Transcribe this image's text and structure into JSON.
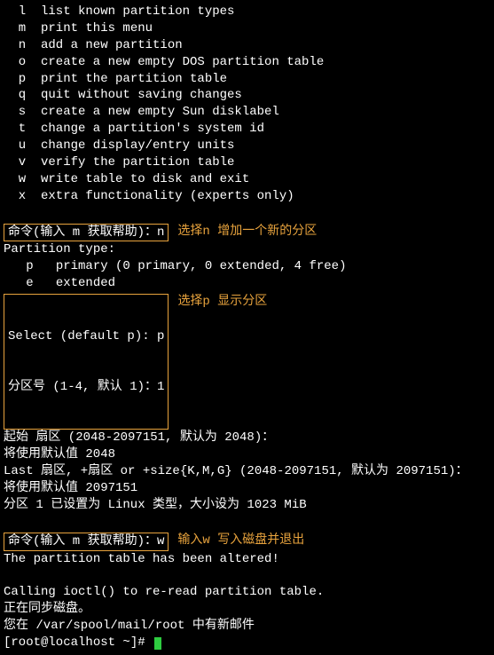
{
  "menu": [
    {
      "key": "l",
      "desc": "list known partition types"
    },
    {
      "key": "m",
      "desc": "print this menu"
    },
    {
      "key": "n",
      "desc": "add a new partition"
    },
    {
      "key": "o",
      "desc": "create a new empty DOS partition table"
    },
    {
      "key": "p",
      "desc": "print the partition table"
    },
    {
      "key": "q",
      "desc": "quit without saving changes"
    },
    {
      "key": "s",
      "desc": "create a new empty Sun disklabel"
    },
    {
      "key": "t",
      "desc": "change a partition's system id"
    },
    {
      "key": "u",
      "desc": "change display/entry units"
    },
    {
      "key": "v",
      "desc": "verify the partition table"
    },
    {
      "key": "w",
      "desc": "write table to disk and exit"
    },
    {
      "key": "x",
      "desc": "extra functionality (experts only)"
    }
  ],
  "box1": {
    "line": "命令(输入 m 获取帮助)：n",
    "annot": "选择n 增加一个新的分区"
  },
  "out1": [
    "Partition type:",
    "   p   primary (0 primary, 0 extended, 4 free)",
    "   e   extended"
  ],
  "box2": {
    "line1": "Select (default p): p",
    "line2": "分区号 (1-4, 默认 1)：1",
    "annot": "选择p 显示分区"
  },
  "out2": [
    "起始 扇区 (2048-2097151, 默认为 2048)：",
    "将使用默认值 2048",
    "Last 扇区, +扇区 or +size{K,M,G} (2048-2097151, 默认为 2097151)：",
    "将使用默认值 2097151",
    "分区 1 已设置为 Linux 类型，大小设为 1023 MiB",
    ""
  ],
  "box3": {
    "line": "命令(输入 m 获取帮助)：w",
    "annot": "输入w 写入磁盘并退出"
  },
  "out3": [
    "The partition table has been altered!",
    "",
    "Calling ioctl() to re-read partition table.",
    "正在同步磁盘。",
    "您在 /var/spool/mail/root 中有新邮件"
  ],
  "prompt": "[root@localhost ~]# "
}
